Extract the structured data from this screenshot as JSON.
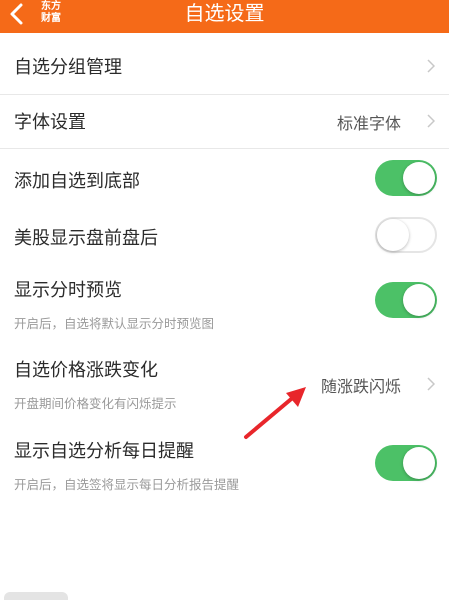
{
  "header": {
    "title": "自选设置",
    "logo_line1": "东方",
    "logo_line2": "财富"
  },
  "rows": {
    "group": {
      "title": "自选分组管理"
    },
    "font": {
      "title": "字体设置",
      "value": "标准字体"
    },
    "add_bottom": {
      "title": "添加自选到底部",
      "toggle": "on"
    },
    "us_stocks": {
      "title": "美股显示盘前盘后",
      "toggle": "off"
    },
    "timeshare": {
      "title": "显示分时预览",
      "subtitle": "开启后，自选将默认显示分时预览图",
      "toggle": "on"
    },
    "price_change": {
      "title": "自选价格涨跌变化",
      "subtitle": "开盘期间价格变化有闪烁提示",
      "value": "随涨跌闪烁"
    },
    "daily_reminder": {
      "title": "显示自选分析每日提醒",
      "subtitle": "开启后，自选签将显示每日分析报告提醒",
      "toggle": "on"
    }
  },
  "colors": {
    "header_bg": "#f56a18",
    "toggle_on": "#4cc167",
    "annotation_arrow": "#e8262b"
  }
}
